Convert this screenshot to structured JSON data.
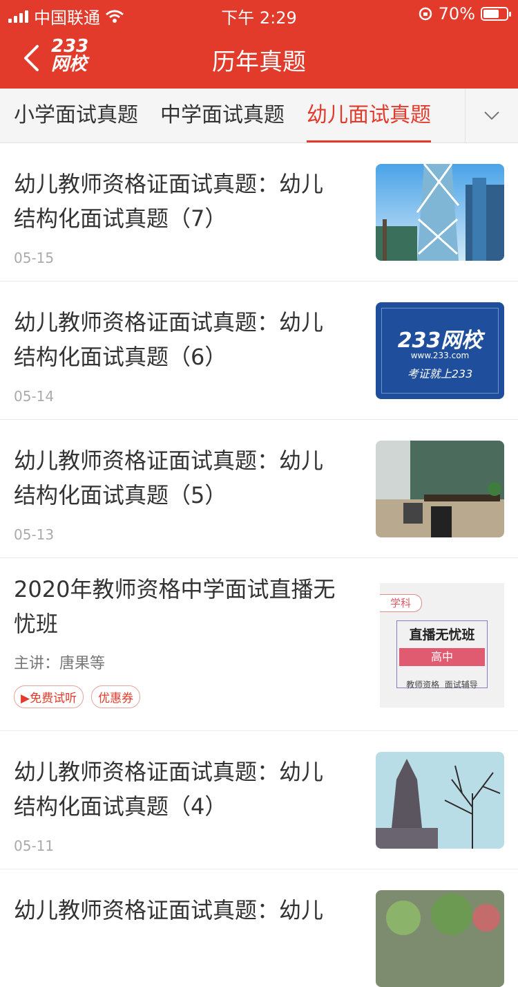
{
  "status_bar": {
    "carrier": "中国联通",
    "time": "下午 2:29",
    "battery": "70%",
    "battery_fraction": 0.7
  },
  "nav": {
    "logo_top": "233",
    "logo_bottom": "网校",
    "title": "历年真题"
  },
  "tabs": [
    {
      "label": "小学面试真题",
      "active": false
    },
    {
      "label": "中学面试真题",
      "active": false
    },
    {
      "label": "幼儿面试真题",
      "active": true
    }
  ],
  "items": [
    {
      "title_line1": "幼儿教师资格证面试真题：幼儿",
      "title_line2": "结构化面试真题（7）",
      "date": "05-15"
    },
    {
      "title_line1": "幼儿教师资格证面试真题：幼儿",
      "title_line2": "结构化面试真题（6）",
      "date": "05-14",
      "thumb_brand": "233网校",
      "thumb_url": "www.233.com",
      "thumb_slogan": "考证就上233"
    },
    {
      "title_line1": "幼儿教师资格证面试真题：幼儿",
      "title_line2": "结构化面试真题（5）",
      "date": "05-13"
    },
    {
      "title_line1": "2020年教师资格中学面试直播无",
      "title_line2": "忧班",
      "teacher": "主讲：唐果等",
      "tag_trial": "▶免费试听",
      "tag_coupon": "优惠券",
      "thumb_subject": "学科",
      "thumb_title": "直播无忧班",
      "thumb_level": "高中",
      "thumb_footer": "教师资格  面试辅导"
    },
    {
      "title_line1": "幼儿教师资格证面试真题：幼儿",
      "title_line2": "结构化面试真题（4）",
      "date": "05-11"
    },
    {
      "title_line1": "幼儿教师资格证面试真题：幼儿"
    }
  ]
}
